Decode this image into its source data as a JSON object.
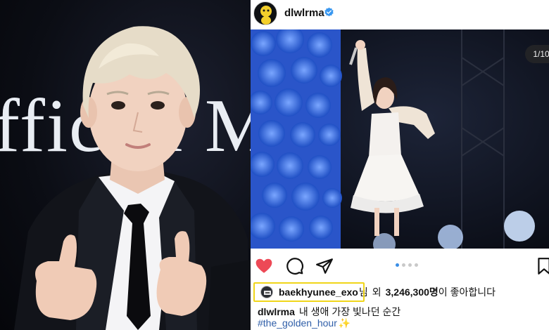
{
  "left_photo": {
    "backdrop_text": "fficial M"
  },
  "post": {
    "username": "dlwlrma",
    "image_counter": "1/10",
    "carousel_active_index": 0,
    "carousel_dots": 4,
    "likes": {
      "user": "baekhyunee_exo",
      "suffix": "님",
      "connector": "외",
      "count": "3,246,300명",
      "tail": "이 좋아합니다"
    },
    "caption": {
      "username": "dlwlrma",
      "text": "내 생애 가장 빛나던 순간"
    },
    "hashtag": "#the_golden_hour",
    "hashtag_emoji": "✨"
  },
  "colors": {
    "like_heart": "#ed4956",
    "verified_badge": "#3897f0",
    "highlight_box": "#f0d61a",
    "hashtag": "#2f5ea8"
  },
  "icons": [
    "heart-icon",
    "comment-icon",
    "share-icon",
    "bookmark-icon",
    "verified-badge-icon"
  ]
}
